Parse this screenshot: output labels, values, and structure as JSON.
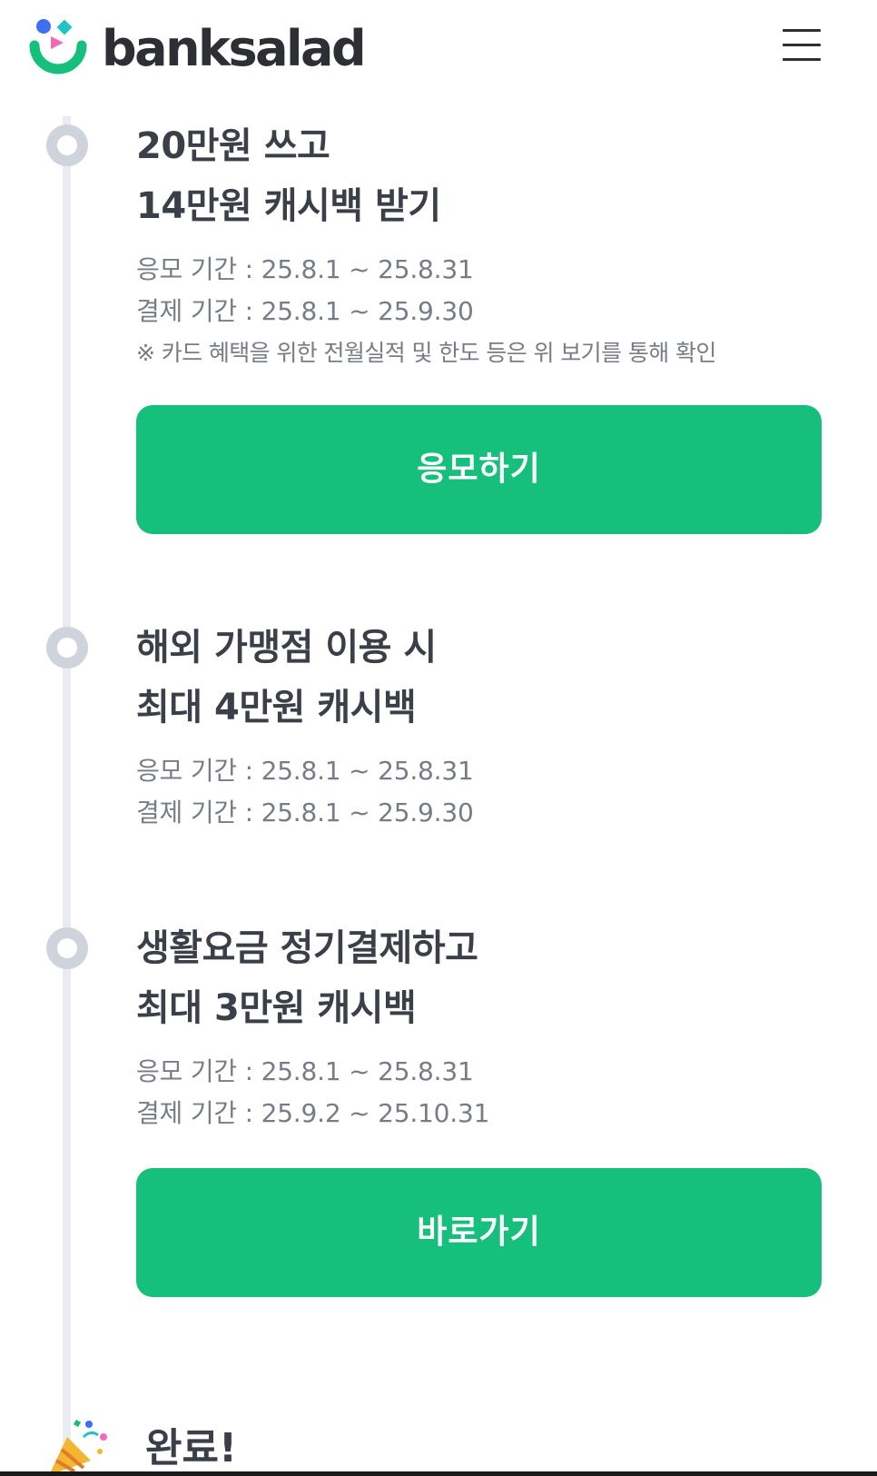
{
  "header": {
    "brand": "banksalad",
    "menu_icon": "hamburger-menu-icon"
  },
  "colors": {
    "primary_green": "#17bf7c",
    "timeline": "#cfd4dc",
    "title_text": "#3a3f48",
    "muted_text": "#777d86"
  },
  "events": [
    {
      "title_line1": "20만원 쓰고",
      "title_line2": "14만원 캐시백 받기",
      "apply_period": "응모 기간 : 25.8.1 ~ 25.8.31",
      "payment_period": "결제 기간 : 25.8.1 ~ 25.9.30",
      "note": "※ 카드 혜택을 위한 전월실적 및 한도 등은 위 보기를 통해 확인",
      "button_label": "응모하기"
    },
    {
      "title_line1": "해외 가맹점 이용 시",
      "title_line2": "최대 4만원 캐시백",
      "apply_period": "응모 기간 : 25.8.1 ~ 25.8.31",
      "payment_period": "결제 기간 : 25.8.1 ~ 25.9.30"
    },
    {
      "title_line1": "생활요금 정기결제하고",
      "title_line2": "최대 3만원 캐시백",
      "apply_period": "응모 기간 : 25.8.1 ~ 25.8.31",
      "payment_period": "결제 기간 : 25.9.2 ~ 25.10.31",
      "button_label": "바로가기"
    }
  ],
  "done": {
    "title": "완료!",
    "icon": "party-popper-icon"
  }
}
